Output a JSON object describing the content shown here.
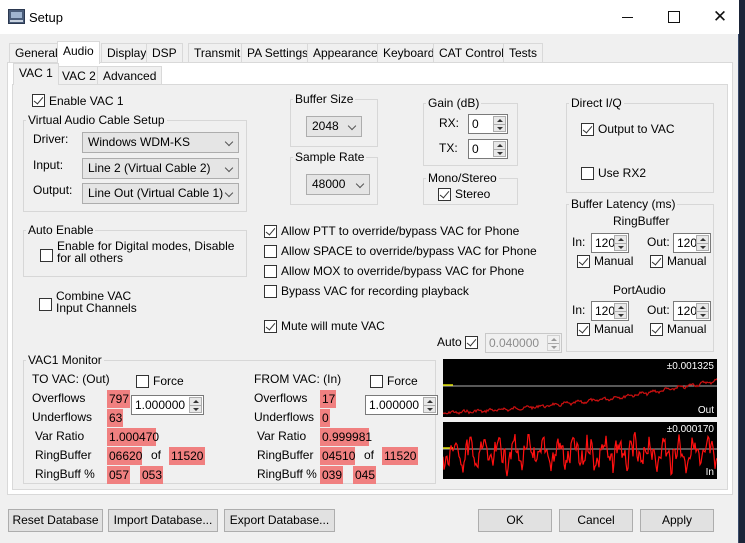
{
  "window": {
    "title": "Setup",
    "minimize_label": "",
    "maximize_label": "",
    "close_label": "✕"
  },
  "tabs": [
    {
      "label": "General"
    },
    {
      "label": "Audio",
      "active": true
    },
    {
      "label": "Display"
    },
    {
      "label": "DSP"
    },
    {
      "label": "Transmit"
    },
    {
      "label": "PA Settings"
    },
    {
      "label": "Appearance"
    },
    {
      "label": "Keyboard"
    },
    {
      "label": "CAT Control"
    },
    {
      "label": "Tests"
    }
  ],
  "subtabs": [
    {
      "label": "VAC 1",
      "active": true
    },
    {
      "label": "VAC 2"
    },
    {
      "label": "Advanced"
    }
  ],
  "enable_vac": {
    "label": "Enable VAC 1",
    "checked": true
  },
  "vac_setup": {
    "title": "Virtual Audio Cable Setup",
    "driver_label": "Driver:",
    "driver_value": "Windows WDM-KS",
    "input_label": "Input:",
    "input_value": "Line 2 (Virtual Cable 2)",
    "output_label": "Output:",
    "output_value": "Line Out (Virtual Cable 1)"
  },
  "buffer_size": {
    "title": "Buffer Size",
    "value": "2048"
  },
  "sample_rate": {
    "title": "Sample Rate",
    "value": "48000"
  },
  "gain": {
    "title": "Gain (dB)",
    "rx_label": "RX:",
    "rx_value": "0",
    "tx_label": "TX:",
    "tx_value": "0"
  },
  "mono_stereo": {
    "title": "Mono/Stereo",
    "stereo_label": "Stereo",
    "stereo_checked": true
  },
  "direct_iq": {
    "title": "Direct I/Q",
    "output_to_vac_label": "Output to VAC",
    "output_to_vac_checked": true,
    "use_rx2_label": "Use RX2",
    "use_rx2_checked": false
  },
  "buffer_latency": {
    "title": "Buffer Latency (ms)",
    "ringbuffer_title": "RingBuffer",
    "portaudio_title": "PortAudio",
    "in_label": "In:",
    "out_label": "Out:",
    "manual_label": "Manual",
    "ring_in": "120",
    "ring_out": "120",
    "port_in": "120",
    "port_out": "120",
    "ring_in_manual": true,
    "ring_out_manual": true,
    "port_in_manual": true,
    "port_out_manual": true
  },
  "auto_enable": {
    "title": "Auto Enable",
    "digital_label_line1": "Enable for Digital modes, Disable",
    "digital_label_line2": "for all others",
    "digital_checked": false
  },
  "combine_vac": {
    "label_line1": "Combine VAC",
    "label_line2": "Input Channels",
    "checked": false
  },
  "options": [
    {
      "label": "Allow PTT to override/bypass VAC for Phone",
      "checked": true
    },
    {
      "label": "Allow SPACE to override/bypass VAC for Phone",
      "checked": false
    },
    {
      "label": "Allow MOX to override/bypass VAC for Phone",
      "checked": false
    },
    {
      "label": "Bypass VAC for recording playback",
      "checked": false
    },
    {
      "label": "Mute will mute VAC",
      "checked": true
    }
  ],
  "auto": {
    "label": "Auto",
    "checked": true,
    "value": "0.040000"
  },
  "monitor": {
    "title": "VAC1 Monitor",
    "to_vac": {
      "header": "TO VAC: (Out)",
      "force_label": "Force",
      "force_checked": false,
      "force_value": "1.000000",
      "overflows_label": "Overflows",
      "overflows": "797",
      "underflows_label": "Underflows",
      "underflows": "63",
      "var_ratio_label": "Var Ratio",
      "var_ratio": "1.000470",
      "ringbuffer_label": "RingBuffer",
      "ringbuffer": "06620",
      "of_label": "of",
      "ringbuffer_total": "11520",
      "ringbuff_pct_label": "RingBuff %",
      "ringbuff_pct_1": "057",
      "ringbuff_pct_2": "053"
    },
    "from_vac": {
      "header": "FROM VAC: (In)",
      "force_label": "Force",
      "force_checked": false,
      "force_value": "1.000000",
      "overflows_label": "Overflows",
      "overflows": "17",
      "underflows_label": "Underflows",
      "underflows": "0",
      "var_ratio_label": "Var Ratio",
      "var_ratio": "0.999981",
      "ringbuffer_label": "RingBuffer",
      "ringbuffer": "04510",
      "of_label": "of",
      "ringbuffer_total": "11520",
      "ringbuff_pct_label": "RingBuff %",
      "ringbuff_pct_1": "039",
      "ringbuff_pct_2": "045"
    },
    "scope_out": {
      "range_label": "±0.001325",
      "tag": "Out",
      "trace_color": "#cc1010",
      "center_color": "#b0b0b0",
      "marker_color": "#e0e000"
    },
    "scope_in": {
      "range_label": "±0.000170",
      "tag": "In",
      "trace_color": "#ff1010",
      "center_color": "#b0b0b0",
      "marker_color": "#e0e000"
    }
  },
  "footer": {
    "reset_label": "Reset Database",
    "import_label": "Import Database...",
    "export_label": "Export Database...",
    "ok_label": "OK",
    "cancel_label": "Cancel",
    "apply_label": "Apply"
  }
}
